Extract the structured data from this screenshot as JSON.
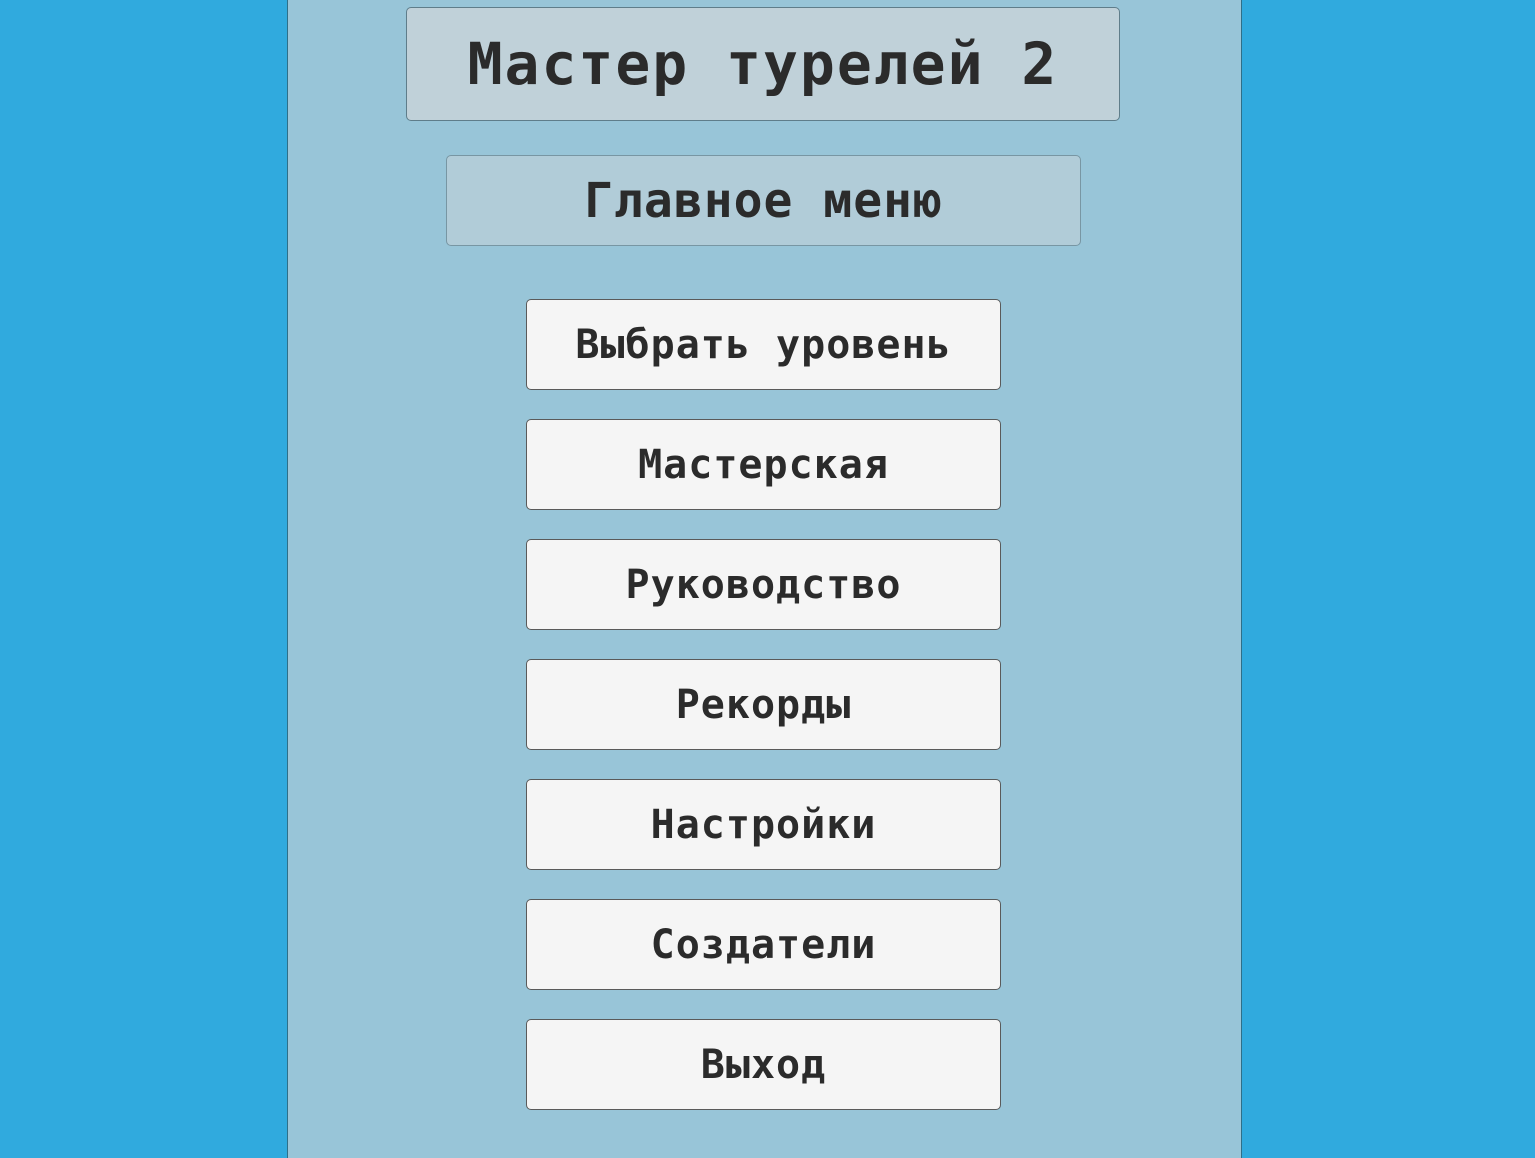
{
  "game": {
    "title": "Мастер турелей 2",
    "screen_title": "Главное меню"
  },
  "menu": {
    "items": [
      {
        "label": "Выбрать уровень"
      },
      {
        "label": "Мастерская"
      },
      {
        "label": "Руководство"
      },
      {
        "label": "Рекорды"
      },
      {
        "label": "Настройки"
      },
      {
        "label": "Создатели"
      },
      {
        "label": "Выход"
      }
    ]
  },
  "colors": {
    "background": "#30aade",
    "panel": "#98c5d8",
    "title_box": "#c0d1d9",
    "subtitle_box": "#b1ccd8",
    "button": "#f5f5f5",
    "text": "#2b2b2b"
  }
}
